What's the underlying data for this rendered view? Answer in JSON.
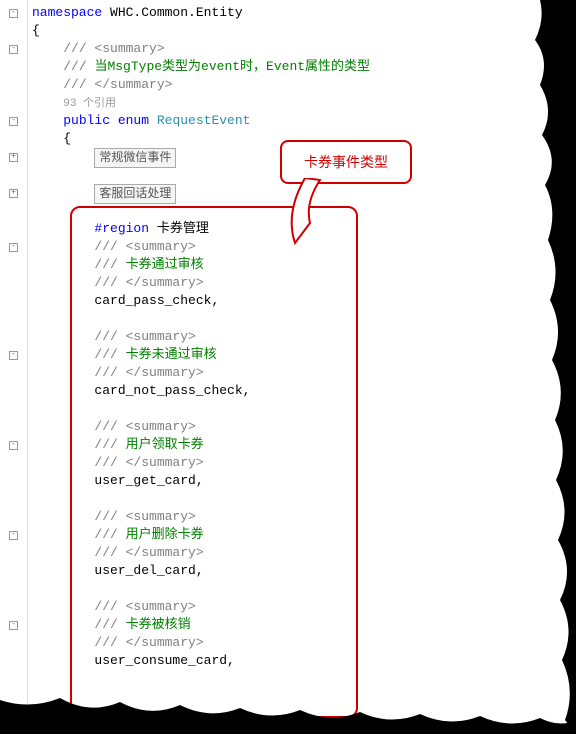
{
  "namespace": {
    "kw": "namespace",
    "name": " WHC.Common.Entity"
  },
  "braces": {
    "open": "{",
    "close": "}"
  },
  "summary": {
    "open": "/// <summary>",
    "close": "/// </summary>",
    "prefix": "/// ",
    "main_desc": "当MsgType类型为event时，Event属性的类型"
  },
  "refs": "93 个引用",
  "enum_decl": {
    "public": "public",
    "enum": " enum ",
    "name": "RequestEvent"
  },
  "collapsed": {
    "region1": "常规微信事件",
    "region2": "客服回话处理"
  },
  "region": {
    "kw": "#region",
    "title": " 卡券管理"
  },
  "members": {
    "m1": {
      "desc": "卡券通过审核",
      "name": "card_pass_check,"
    },
    "m2": {
      "desc": "卡券未通过审核",
      "name": "card_not_pass_check,"
    },
    "m3": {
      "desc": "用户领取卡券",
      "name": "user_get_card,"
    },
    "m4": {
      "desc": "用户删除卡券",
      "name": "user_del_card,"
    },
    "m5": {
      "desc": "卡券被核销",
      "name": "user_consume_card,"
    }
  },
  "callout": "卡券事件类型"
}
